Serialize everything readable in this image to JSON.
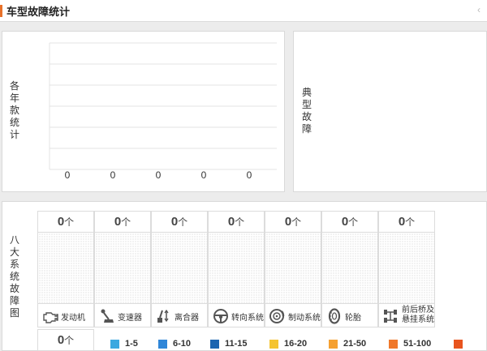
{
  "header": {
    "title": "车型故障统计",
    "accent_color": "#e8712a",
    "collapse_icon": "chevron-left-icon"
  },
  "model_count": {
    "label_chars": [
      "各",
      "年",
      "款",
      "统",
      "计"
    ],
    "chart_data": {
      "type": "bar",
      "title": "",
      "xlabel": "",
      "ylabel": "",
      "categories": [
        "",
        "",
        "",
        "",
        ""
      ],
      "values": [
        0,
        0,
        0,
        0,
        0
      ],
      "data_labels": [
        "0",
        "0",
        "0",
        "0",
        "0"
      ],
      "grid": true
    }
  },
  "typical_fault": {
    "label_chars": [
      "典",
      "型",
      "故",
      "障"
    ]
  },
  "eight_systems": {
    "label_chars": [
      "八",
      "大",
      "系",
      "统",
      "故",
      "障",
      "图"
    ],
    "unit": "个",
    "systems": [
      {
        "name": "发动机",
        "count": "0",
        "icon": "engine-icon"
      },
      {
        "name": "变速器",
        "count": "0",
        "icon": "gear-shift-icon"
      },
      {
        "name": "离合器",
        "count": "0",
        "icon": "clutch-pedal-icon"
      },
      {
        "name": "转向系统",
        "count": "0",
        "icon": "steering-wheel-icon"
      },
      {
        "name": "制动系统",
        "count": "0",
        "icon": "brake-disc-icon"
      },
      {
        "name": "轮胎",
        "count": "0",
        "icon": "tire-icon"
      },
      {
        "name_line1": "前后桥及",
        "name_line2": "悬挂系统",
        "count": "0",
        "icon": "axle-suspension-icon"
      }
    ],
    "extra_count": "0",
    "legend": [
      {
        "label": "1-5",
        "color": "#3ba8e0"
      },
      {
        "label": "6-10",
        "color": "#2f86d8"
      },
      {
        "label": "11-15",
        "color": "#1a64b0"
      },
      {
        "label": "16-20",
        "color": "#f5c431"
      },
      {
        "label": "21-50",
        "color": "#f5a031"
      },
      {
        "label": "51-100",
        "color": "#f0782a"
      },
      {
        "label": "",
        "color": "#e8541e"
      }
    ]
  }
}
